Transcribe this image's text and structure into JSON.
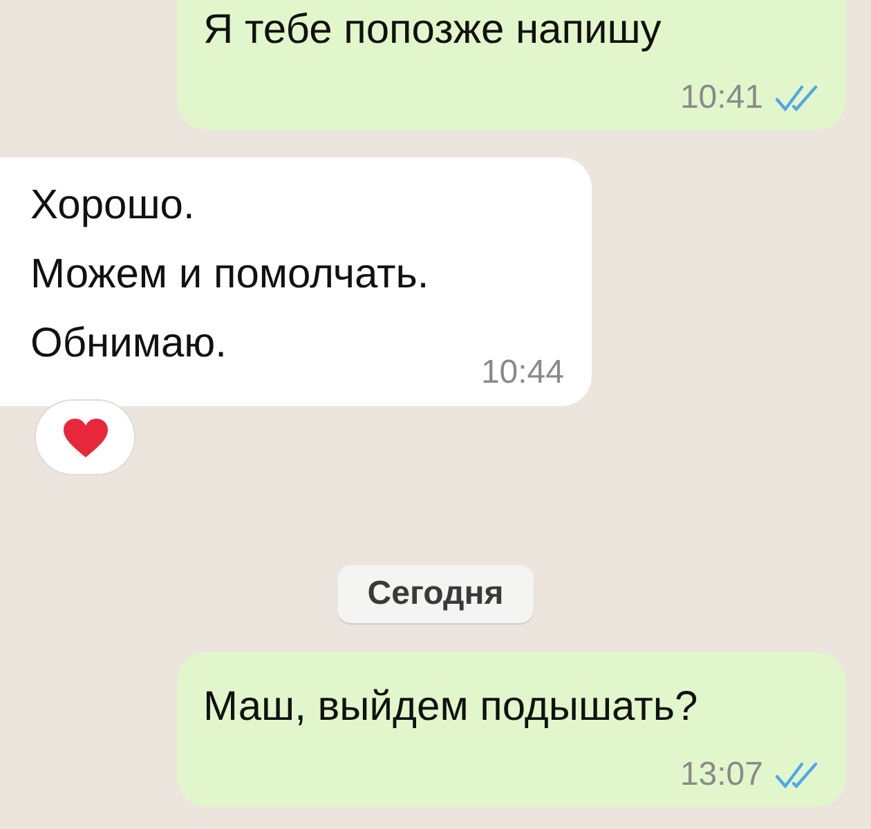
{
  "messages": [
    {
      "kind": "outgoing",
      "lines": [
        "Я тебе попозже напишу"
      ],
      "time": "10:41",
      "read": true
    },
    {
      "kind": "incoming",
      "lines": [
        "Хорошо.",
        "Можем и помолчать.",
        "Обнимаю."
      ],
      "time": "10:44",
      "reaction": {
        "kind": "heart"
      }
    },
    {
      "kind": "date",
      "text": "Сегодня"
    },
    {
      "kind": "outgoing",
      "lines": [
        "Маш, выйдем подышать?"
      ],
      "time": "13:07",
      "read": true
    }
  ]
}
